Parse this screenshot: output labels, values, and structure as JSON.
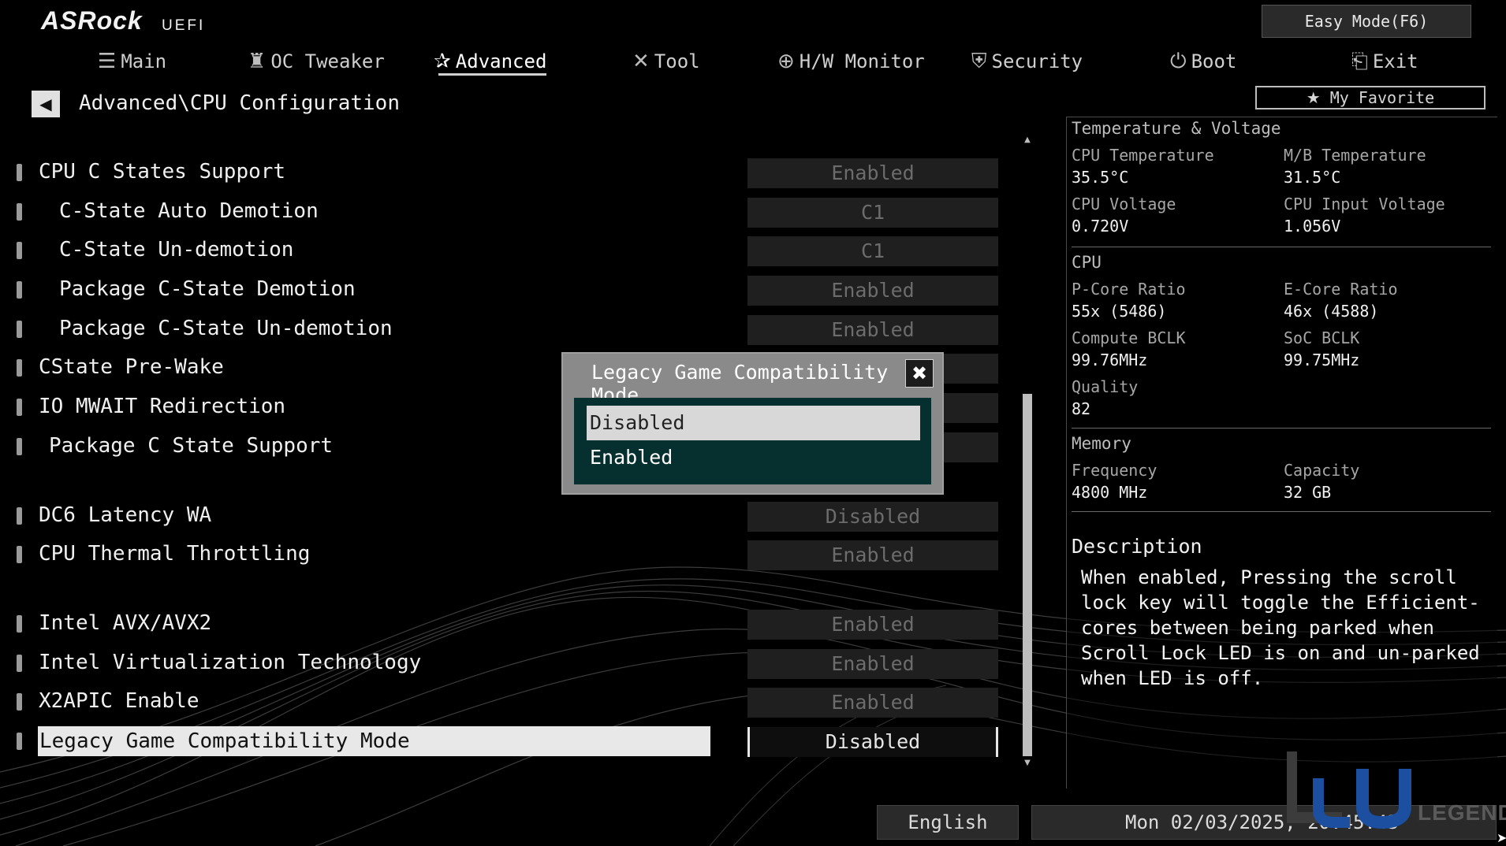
{
  "header": {
    "logo": "ASRock",
    "logo_sub": "UEFI",
    "easy_mode": "Easy Mode(F6)",
    "my_favorite": "My Favorite",
    "tabs": [
      {
        "label": "Main",
        "icon": "list-icon"
      },
      {
        "label": "OC Tweaker",
        "icon": "rocket-icon"
      },
      {
        "label": "Advanced",
        "icon": "star-icon",
        "active": true
      },
      {
        "label": "Tool",
        "icon": "tools-icon"
      },
      {
        "label": "H/W Monitor",
        "icon": "crosshair-icon"
      },
      {
        "label": "Security",
        "icon": "shield-icon"
      },
      {
        "label": "Boot",
        "icon": "power-icon"
      },
      {
        "label": "Exit",
        "icon": "exit-icon"
      }
    ]
  },
  "breadcrumb": "Advanced\\CPU Configuration",
  "settings": [
    {
      "label": "CPU C States Support",
      "value": "Enabled"
    },
    {
      "label": "C-State Auto Demotion",
      "value": "C1"
    },
    {
      "label": "C-State Un-demotion",
      "value": "C1"
    },
    {
      "label": "Package C-State Demotion",
      "value": "Enabled"
    },
    {
      "label": "Package C-State Un-demotion",
      "value": "Enabled"
    },
    {
      "label": "CState Pre-Wake",
      "value": ""
    },
    {
      "label": "IO MWAIT Redirection",
      "value": ""
    },
    {
      "label": "Package C State Support",
      "value": ""
    },
    {
      "label": "DC6 Latency WA",
      "value": "Disabled"
    },
    {
      "label": "CPU Thermal Throttling",
      "value": "Enabled"
    },
    {
      "label": "Intel AVX/AVX2",
      "value": "Enabled"
    },
    {
      "label": "Intel Virtualization Technology",
      "value": "Enabled"
    },
    {
      "label": "X2APIC Enable",
      "value": "Enabled"
    },
    {
      "label": "Legacy Game Compatibility Mode",
      "value": "Disabled",
      "selected": true
    }
  ],
  "popup": {
    "title": "Legacy Game Compatibility Mode",
    "options": [
      "Disabled",
      "Enabled"
    ],
    "highlighted": "Disabled"
  },
  "hw_monitor": {
    "temp_section": "Temperature & Voltage",
    "cpu_temp_label": "CPU Temperature",
    "cpu_temp": "35.5°C",
    "mb_temp_label": "M/B Temperature",
    "mb_temp": "31.5°C",
    "cpu_voltage_label": "CPU Voltage",
    "cpu_voltage": "0.720V",
    "cpu_input_voltage_label": "CPU Input Voltage",
    "cpu_input_voltage": "1.056V",
    "cpu_section": "CPU",
    "pcore_label": "P-Core Ratio",
    "pcore": "55x (5486)",
    "ecore_label": "E-Core Ratio",
    "ecore": "46x (4588)",
    "compute_bclk_label": "Compute BCLK",
    "compute_bclk": "99.76MHz",
    "soc_bclk_label": "SoC BCLK",
    "soc_bclk": "99.75MHz",
    "quality_label": "Quality",
    "quality": "82",
    "memory_section": "Memory",
    "frequency_label": "Frequency",
    "frequency": "4800 MHz",
    "capacity_label": "Capacity",
    "capacity": "32 GB"
  },
  "description": {
    "title": "Description",
    "text": "When enabled, Pressing the scroll lock key will toggle the Efficient-cores between being parked when Scroll Lock LED is on and un-parked when LED is off."
  },
  "footer": {
    "language": "English",
    "datetime": "Mon 02/03/2025, 20:45:43"
  },
  "watermark": {
    "text": "LEGEND"
  }
}
